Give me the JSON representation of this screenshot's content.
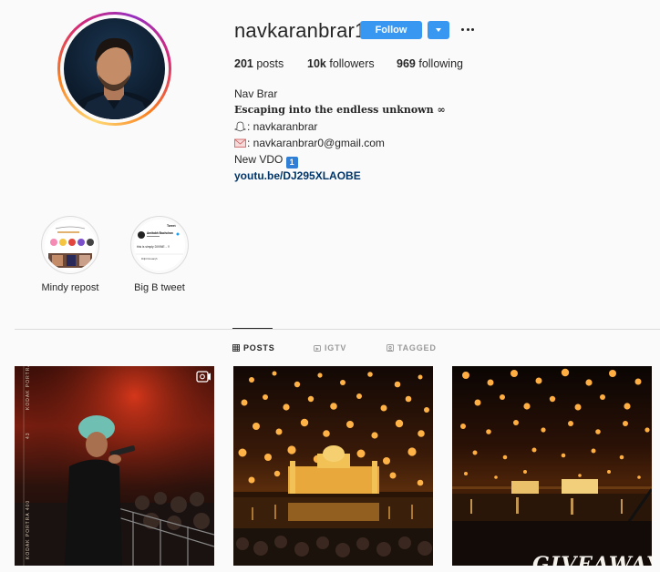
{
  "profile": {
    "username": "navkaranbrar1",
    "follow_label": "Follow",
    "stats": {
      "posts": "201",
      "posts_label": "posts",
      "followers": "10k",
      "followers_label": "followers",
      "following": "969",
      "following_label": "following"
    },
    "bio": {
      "name": "Nav Brar",
      "tagline": "Escaping into the endless unknown ∞",
      "snapchat": ": navkaranbrar",
      "email": ": navkaranbrar0@gmail.com",
      "new_video": "New VDO",
      "new_video_badge": "1",
      "link": "youtu.be/DJ295XLAOBE"
    }
  },
  "highlights": [
    {
      "label": "Mindy repost"
    },
    {
      "label": "Big B tweet",
      "tweet_header": "Tweet",
      "tweet_author": "Amitabh Bachchan",
      "tweet_text": "this is simply DIVINE .. !!",
      "tweet_footer": "Diljit Dosanjh"
    }
  ],
  "tabs": [
    {
      "label": "POSTS",
      "icon": "grid-icon",
      "active": true
    },
    {
      "label": "IGTV",
      "icon": "igtv-icon",
      "active": false
    },
    {
      "label": "TAGGED",
      "icon": "tag-icon",
      "active": false
    }
  ],
  "posts": [
    {
      "type": "video",
      "film_text": "KODAK PORTRA 400",
      "film_number": "43"
    },
    {
      "type": "image"
    },
    {
      "type": "image",
      "overlay_text": "GIVEAWAY"
    }
  ],
  "colors": {
    "accent": "#3897f0",
    "link": "#003569",
    "divider": "#dbdbdb"
  }
}
